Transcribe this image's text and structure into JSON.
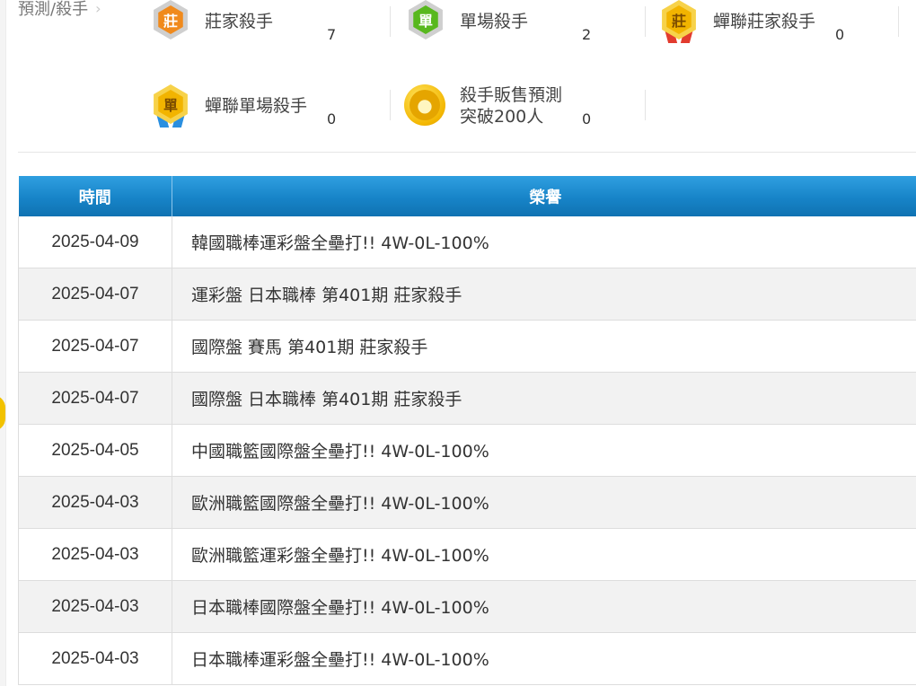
{
  "breadcrumb": {
    "text": "預測/殺手",
    "chevron": "›"
  },
  "stats": [
    {
      "icon": "hex-badge-orange-icon",
      "label": "莊家殺手",
      "count": "7"
    },
    {
      "icon": "hex-badge-green-icon",
      "label": "單場殺手",
      "count": "2"
    },
    {
      "icon": "ribbon-badge-gold-icon",
      "label": "蟬聯莊家殺手",
      "count": "0"
    },
    {
      "icon": "ribbon-badge-blue-icon",
      "label": "蟬聯單場殺手",
      "count": "0"
    },
    {
      "icon": "gold-coin-people-icon",
      "label_line1": "殺手販售預測",
      "label_line2": "突破200人",
      "count": "0"
    }
  ],
  "badge_glyphs": {
    "z": "莊",
    "d": "單"
  },
  "table": {
    "headers": {
      "time": "時間",
      "honor": "榮譽"
    },
    "rows": [
      {
        "date": "2025-04-09",
        "honor": "韓國職棒運彩盤全壘打!! 4W-0L-100%"
      },
      {
        "date": "2025-04-07",
        "honor": "運彩盤 日本職棒 第401期 莊家殺手"
      },
      {
        "date": "2025-04-07",
        "honor": "國際盤 賽馬 第401期 莊家殺手"
      },
      {
        "date": "2025-04-07",
        "honor": "國際盤 日本職棒 第401期 莊家殺手"
      },
      {
        "date": "2025-04-05",
        "honor": "中國職籃國際盤全壘打!! 4W-0L-100%"
      },
      {
        "date": "2025-04-03",
        "honor": "歐洲職籃國際盤全壘打!! 4W-0L-100%"
      },
      {
        "date": "2025-04-03",
        "honor": "歐洲職籃運彩盤全壘打!! 4W-0L-100%"
      },
      {
        "date": "2025-04-03",
        "honor": "日本職棒國際盤全壘打!! 4W-0L-100%"
      },
      {
        "date": "2025-04-03",
        "honor": "日本職棒運彩盤全壘打!! 4W-0L-100%"
      }
    ]
  },
  "colors": {
    "count_blue": "#1f8fd6",
    "header_blue": "#1784c8",
    "row_alt": "#f2f2f2",
    "badge_orange": "#f08a1c",
    "badge_green": "#58b81e",
    "badge_gold": "#f2b400",
    "ribbon_red": "#e23b2e",
    "ribbon_blue": "#2a8fe0"
  }
}
